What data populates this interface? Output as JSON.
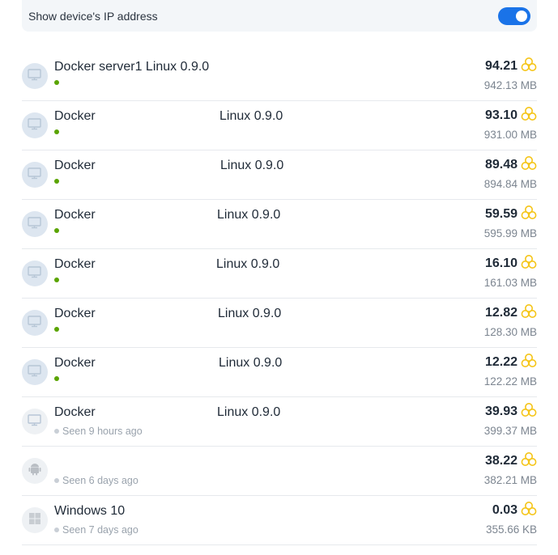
{
  "settings": {
    "show_ip_label": "Show device's IP address",
    "show_ip_enabled": true
  },
  "colors": {
    "accent": "#1a73e8",
    "online": "#5aa400",
    "coin": "#f5c518"
  },
  "devices": [
    {
      "name": "Docker server1 Linux 0.9.0",
      "os": "",
      "status": "",
      "online": true,
      "value": "94.21",
      "size": "942.13 MB",
      "icon": "monitor-icon"
    },
    {
      "name": "Docker",
      "os": "Linux 0.9.0",
      "status": "",
      "online": true,
      "value": "93.10",
      "size": "931.00 MB",
      "icon": "monitor-icon"
    },
    {
      "name": "Docker",
      "os": "Linux 0.9.0",
      "status": "",
      "online": true,
      "value": "89.48",
      "size": "894.84 MB",
      "icon": "monitor-icon"
    },
    {
      "name": "Docker",
      "os": "Linux 0.9.0",
      "status": "",
      "online": true,
      "value": "59.59",
      "size": "595.99 MB",
      "icon": "monitor-icon"
    },
    {
      "name": "Docker",
      "os": "Linux 0.9.0",
      "status": "",
      "online": true,
      "value": "16.10",
      "size": "161.03 MB",
      "icon": "monitor-icon"
    },
    {
      "name": "Docker",
      "os": "Linux 0.9.0",
      "status": "",
      "online": true,
      "value": "12.82",
      "size": "128.30 MB",
      "icon": "monitor-icon"
    },
    {
      "name": "Docker",
      "os": "Linux 0.9.0",
      "status": "",
      "online": true,
      "value": "12.22",
      "size": "122.22 MB",
      "icon": "monitor-icon"
    },
    {
      "name": "Docker",
      "os": "Linux 0.9.0",
      "status": "Seen 9 hours ago",
      "online": false,
      "value": "39.93",
      "size": "399.37 MB",
      "icon": "monitor-icon"
    },
    {
      "name": "",
      "os": "",
      "status": "Seen 6 days ago",
      "online": false,
      "value": "38.22",
      "size": "382.21 MB",
      "icon": "android-icon"
    },
    {
      "name": "Windows 10",
      "os": "",
      "status": "Seen 7 days ago",
      "online": false,
      "value": "0.03",
      "size": "355.66 KB",
      "icon": "windows-icon"
    }
  ]
}
